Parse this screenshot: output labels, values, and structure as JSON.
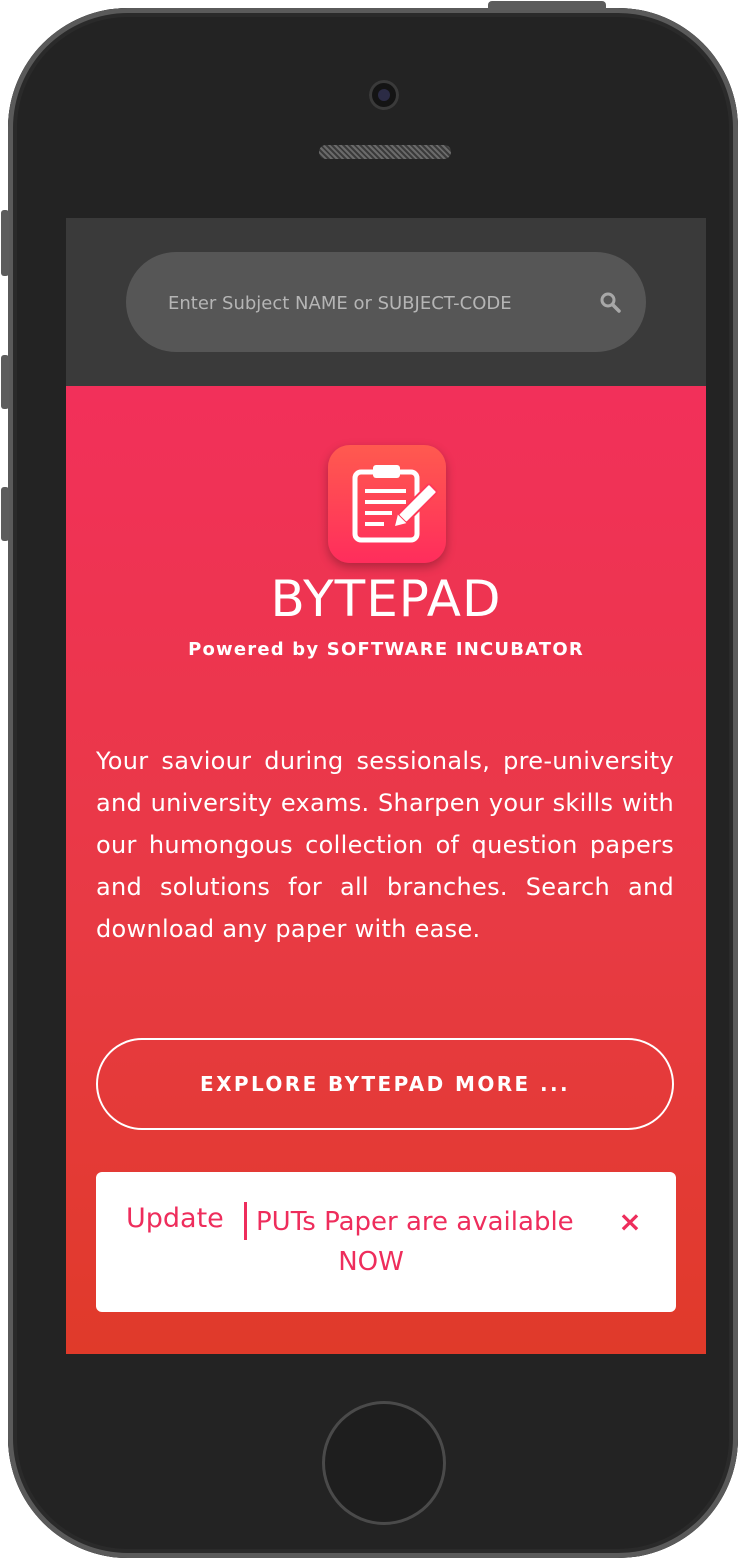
{
  "search": {
    "placeholder": "Enter Subject NAME or SUBJECT-CODE",
    "icon": "search-icon"
  },
  "hero": {
    "title": "BYTEPAD",
    "subtitle": "Powered by SOFTWARE INCUBATOR",
    "app_icon": "clipboard-pencil-icon",
    "description": "Your saviour during sessionals, pre-university and university exams. Sharpen your skills with our humongous collection of question papers and solutions for all branches. Search and download any paper with ease.",
    "explore_label": "EXPLORE BYTEPAD MORE ..."
  },
  "notice": {
    "tag": "Update",
    "message_line1": "PUTs Paper are available",
    "message_line2": "NOW",
    "close_label": "×"
  },
  "colors": {
    "accent": "#ee2d5c",
    "hero_top": "#f2305a",
    "hero_bottom": "#e03a2a",
    "topbar": "#3a3a3a",
    "search_bg": "#565656"
  }
}
